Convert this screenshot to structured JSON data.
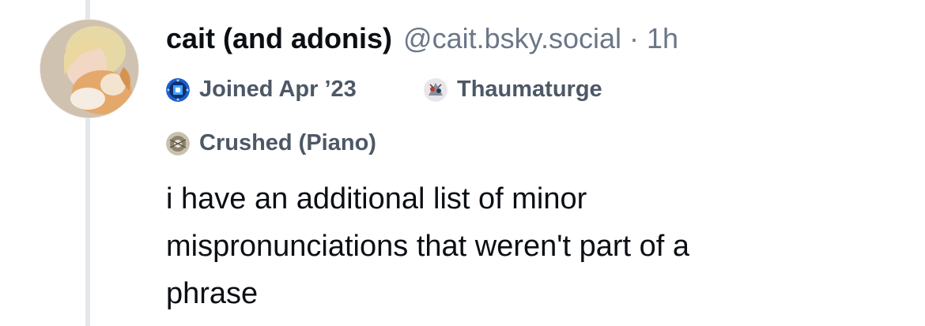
{
  "post": {
    "author": {
      "display_name": "cait (and adonis)",
      "handle": "@cait.bsky.social",
      "separator": "·",
      "timestamp": "1h",
      "avatar_icon": "avatar-photo-person-with-cat"
    },
    "badges": [
      {
        "icon": "calendar-blue-badge-icon",
        "label": "Joined Apr ’23"
      },
      {
        "icon": "thaumaturge-badge-icon",
        "label": "Thaumaturge"
      },
      {
        "icon": "crushed-badge-icon",
        "label": "Crushed (Piano)"
      }
    ],
    "text": "i have an additional list of minor\nmispronunciations that weren't part of a\nphrase"
  },
  "colors": {
    "name": "#0b0f14",
    "muted": "#6b7787",
    "badge_text": "#4d5866",
    "thread_line": "#e4e7ea",
    "badge_blue": "#1e6fd9"
  }
}
